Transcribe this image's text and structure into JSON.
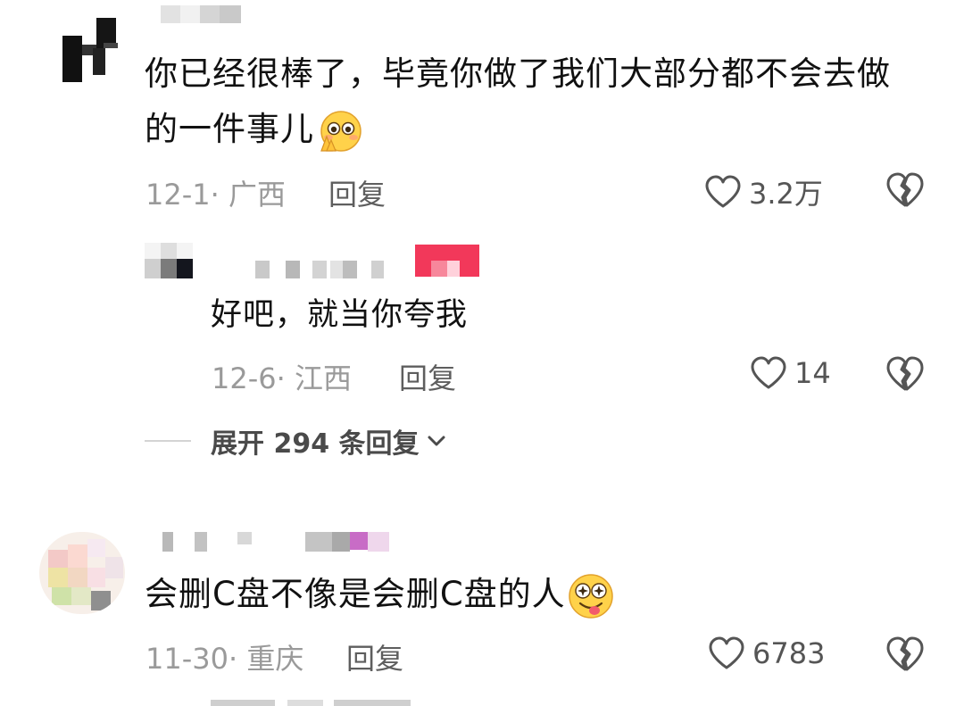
{
  "comments": [
    {
      "text": "你已经很棒了，毕竟你做了我们大部分都不会去做",
      "text2": "的一件事儿",
      "emoji": "pleading-hands-emoji",
      "date": "12-1",
      "location": "广西",
      "reply_label": "回复",
      "likes": "3.2万",
      "replies": [
        {
          "text": "好吧，就当你夸我",
          "date": "12-6",
          "location": "江西",
          "reply_label": "回复",
          "likes": "14"
        }
      ],
      "expand_label": "展开 294 条回复"
    },
    {
      "text": "会删C盘不像是会删C盘的人",
      "emoji": "dizzy-tongue-emoji",
      "date": "11-30",
      "location": "重庆",
      "reply_label": "回复",
      "likes": "6783"
    }
  ],
  "colors": {
    "meta": "#9a9a9a",
    "author_badge": "#f2385a",
    "emoji_yellow": "#ffd24a"
  },
  "icons": {
    "like": "heart-outline-icon",
    "dislike": "broken-heart-icon",
    "expand": "chevron-down-icon"
  }
}
